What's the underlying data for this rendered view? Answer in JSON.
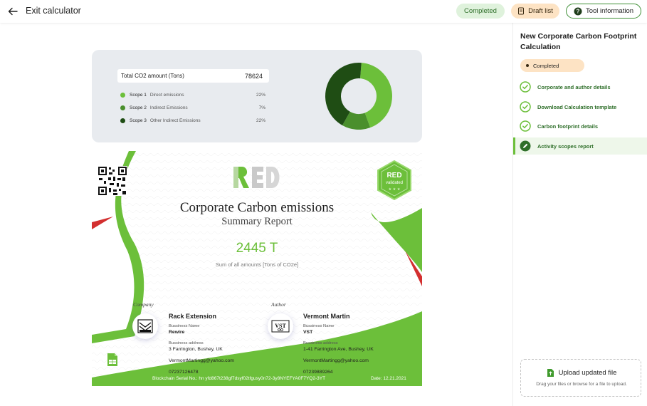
{
  "header": {
    "exit_label": "Exit calculator",
    "completed_label": "Completed",
    "draft_label": "Draft list",
    "tool_info_label": "Tool information"
  },
  "summary": {
    "total_label": "Total CO2 amount (Tons)",
    "total_value": "78624",
    "scopes": [
      {
        "name": "Scope 1",
        "desc": "Direct emissions",
        "pct": "22%",
        "color": "#6cbf3a"
      },
      {
        "name": "Scope 2",
        "desc": "Indirect Emissions",
        "pct": "7%",
        "color": "#4a8f2c"
      },
      {
        "name": "Scope 3",
        "desc": "Other Indirect Emissions",
        "pct": "22%",
        "color": "#1f4d14"
      }
    ]
  },
  "certificate": {
    "title": "Corporate Carbon emissions",
    "subtitle": "Summary Report",
    "badge_top": "RED",
    "badge_bottom": "validated",
    "amount": "2445 T",
    "amount_label": "Sum of all amounts [Tons of CO2e]",
    "company": {
      "role": "Company",
      "name": "Rack Extension",
      "bname_label": "Bussiness Name",
      "bname": "Rewire",
      "addr_label": "Bussiness address",
      "addr": "3 Farrington, Bushey, UK",
      "email": "VermontMartingg@yahoo.com",
      "phone": "07237126478"
    },
    "author": {
      "role": "Author",
      "name": "Vermont Martin",
      "bname_label": "Bussiness Name",
      "bname": "VST",
      "addr_label": "Bussiness address",
      "addr": "1-41 Farrington Ave, Bushey, UK",
      "email": "VermontMartingg@yahoo.com",
      "phone": "07239889264"
    },
    "serial": "Blockchain Serial  No.: hn yfd867t238gf7dsyf02tfgusy0n72-3y8NYEFYA0F7YQ2-3YT",
    "date": "Date: 12.21.2021"
  },
  "sidebar": {
    "title": "New Corporate Carbon Footprint Calculation",
    "status": "Completed",
    "steps": [
      {
        "label": "Corporate and author details"
      },
      {
        "label": "Download Calculation template"
      },
      {
        "label": "Carbon footprint details"
      },
      {
        "label": "Activity scopes report"
      }
    ],
    "upload_label": "Upload updated file",
    "upload_hint": "Drag your files or browse for a file to upload."
  },
  "colors": {
    "accent": "#6cbf3a",
    "dark_green": "#2f6f2a",
    "completed_bg": "#dff2dc",
    "draft_bg": "#fde3c4",
    "red_accent": "#d32f2f"
  },
  "chart_data": {
    "type": "pie",
    "categories": [
      "Scope 1",
      "Scope 2",
      "Scope 3"
    ],
    "values": [
      22,
      7,
      22
    ]
  }
}
